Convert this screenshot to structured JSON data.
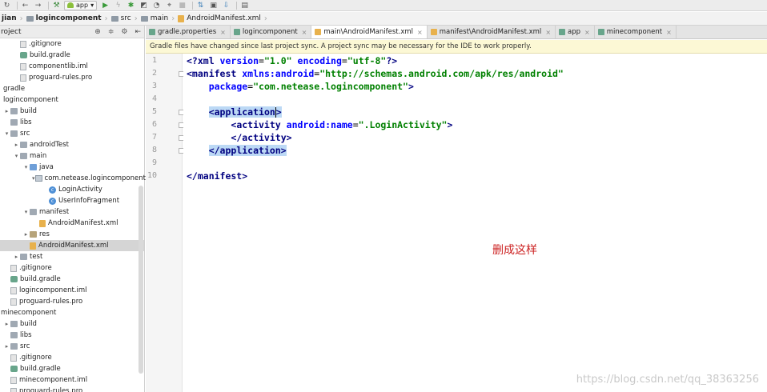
{
  "toolbar": {
    "run_config": "app"
  },
  "breadcrumb": [
    {
      "label": "jian",
      "bold": true
    },
    {
      "label": "logincomponent",
      "bold": true
    },
    {
      "label": "src",
      "bold": false
    },
    {
      "label": "main",
      "bold": false
    },
    {
      "label": "AndroidManifest.xml",
      "bold": false
    }
  ],
  "project_panel": {
    "title": "roject",
    "tree": [
      {
        "label": ".gitignore",
        "indent": 1,
        "icon": "file",
        "arrow": ""
      },
      {
        "label": "build.gradle",
        "indent": 1,
        "icon": "gradle",
        "arrow": ""
      },
      {
        "label": "componentlib.iml",
        "indent": 1,
        "icon": "file",
        "arrow": ""
      },
      {
        "label": "proguard-rules.pro",
        "indent": 1,
        "icon": "file",
        "arrow": ""
      },
      {
        "label": "gradle",
        "indent": 0,
        "icon": "none",
        "arrow": ""
      },
      {
        "label": "logincomponent",
        "indent": 0,
        "icon": "none",
        "arrow": ""
      },
      {
        "label": "build",
        "indent": 0,
        "icon": "folder",
        "arrow": "▶"
      },
      {
        "label": "libs",
        "indent": 0,
        "icon": "folder",
        "arrow": ""
      },
      {
        "label": "src",
        "indent": 0,
        "icon": "folder",
        "arrow": "▼"
      },
      {
        "label": "androidTest",
        "indent": 1,
        "icon": "folder",
        "arrow": "▶"
      },
      {
        "label": "main",
        "indent": 1,
        "icon": "folder",
        "arrow": "▼"
      },
      {
        "label": "java",
        "indent": 2,
        "icon": "java-folder",
        "arrow": "▼"
      },
      {
        "label": "com.netease.logincomponent",
        "indent": 3,
        "icon": "package",
        "arrow": "▼"
      },
      {
        "label": "LoginActivity",
        "indent": 4,
        "icon": "cls",
        "arrow": ""
      },
      {
        "label": "UserInfoFragment",
        "indent": 4,
        "icon": "cls",
        "arrow": ""
      },
      {
        "label": "manifest",
        "indent": 2,
        "icon": "folder",
        "arrow": "▼"
      },
      {
        "label": "AndroidManifest.xml",
        "indent": 3,
        "icon": "xml",
        "arrow": ""
      },
      {
        "label": "res",
        "indent": 2,
        "icon": "res-folder",
        "arrow": "▶"
      },
      {
        "label": "AndroidManifest.xml",
        "indent": 2,
        "icon": "xml",
        "arrow": "",
        "selected": true
      },
      {
        "label": "test",
        "indent": 1,
        "icon": "folder",
        "arrow": "▶"
      },
      {
        "label": ".gitignore",
        "indent": 0,
        "icon": "file",
        "arrow": ""
      },
      {
        "label": "build.gradle",
        "indent": 0,
        "icon": "gradle",
        "arrow": ""
      },
      {
        "label": "logincomponent.iml",
        "indent": 0,
        "icon": "file",
        "arrow": ""
      },
      {
        "label": "proguard-rules.pro",
        "indent": 0,
        "icon": "file",
        "arrow": ""
      },
      {
        "label": "minecomponent",
        "indent": -1,
        "icon": "none",
        "arrow": ""
      },
      {
        "label": "build",
        "indent": 0,
        "icon": "folder",
        "arrow": "▶"
      },
      {
        "label": "libs",
        "indent": 0,
        "icon": "folder",
        "arrow": ""
      },
      {
        "label": "src",
        "indent": 0,
        "icon": "folder",
        "arrow": "▶"
      },
      {
        "label": ".gitignore",
        "indent": 0,
        "icon": "file",
        "arrow": ""
      },
      {
        "label": "build.gradle",
        "indent": 0,
        "icon": "gradle",
        "arrow": ""
      },
      {
        "label": "minecomponent.iml",
        "indent": 0,
        "icon": "file",
        "arrow": ""
      },
      {
        "label": "proguard-rules.pro",
        "indent": 0,
        "icon": "file",
        "arrow": ""
      }
    ]
  },
  "tabs": [
    {
      "label": "gradle.properties",
      "color": "#68a58b",
      "active": false
    },
    {
      "label": "logincomponent",
      "color": "#68a58b",
      "active": false
    },
    {
      "label": "main\\AndroidManifest.xml",
      "color": "#e8b14c",
      "active": true
    },
    {
      "label": "manifest\\AndroidManifest.xml",
      "color": "#e8b14c",
      "active": false
    },
    {
      "label": "app",
      "color": "#68a58b",
      "active": false
    },
    {
      "label": "minecomponent",
      "color": "#68a58b",
      "active": false
    }
  ],
  "notification": "Gradle files have changed since last project sync. A project sync may be necessary for the IDE to work properly.",
  "code": {
    "line_numbers": [
      "1",
      "2",
      "3",
      "4",
      "5",
      "6",
      "7",
      "8",
      "9",
      "10"
    ],
    "line1": {
      "a": "<?xml ",
      "b": "version",
      "c": "=",
      "d": "\"1.0\"",
      "e": " ",
      "f": "encoding",
      "g": "=",
      "h": "\"utf-8\"",
      "i": "?>"
    },
    "line2": {
      "a": "<manifest ",
      "b": "xmlns:android",
      "c": "=",
      "d": "\"http://schemas.android.com/apk/res/android\""
    },
    "line3": {
      "a": "    ",
      "b": "package",
      "c": "=",
      "d": "\"com.netease.logincomponent\"",
      "e": ">"
    },
    "line5": {
      "a": "<application",
      "b": ">"
    },
    "line6": {
      "a": "<activity ",
      "b": "android:name",
      "c": "=",
      "d": "\".LoginActivity\"",
      "e": ">"
    },
    "line7": "</activity>",
    "line8": {
      "a": "</appl",
      "b": "ication>"
    },
    "line10": "</manifest>"
  },
  "annotation": "删成这样",
  "watermark": "https://blog.csdn.net/qq_38363256"
}
